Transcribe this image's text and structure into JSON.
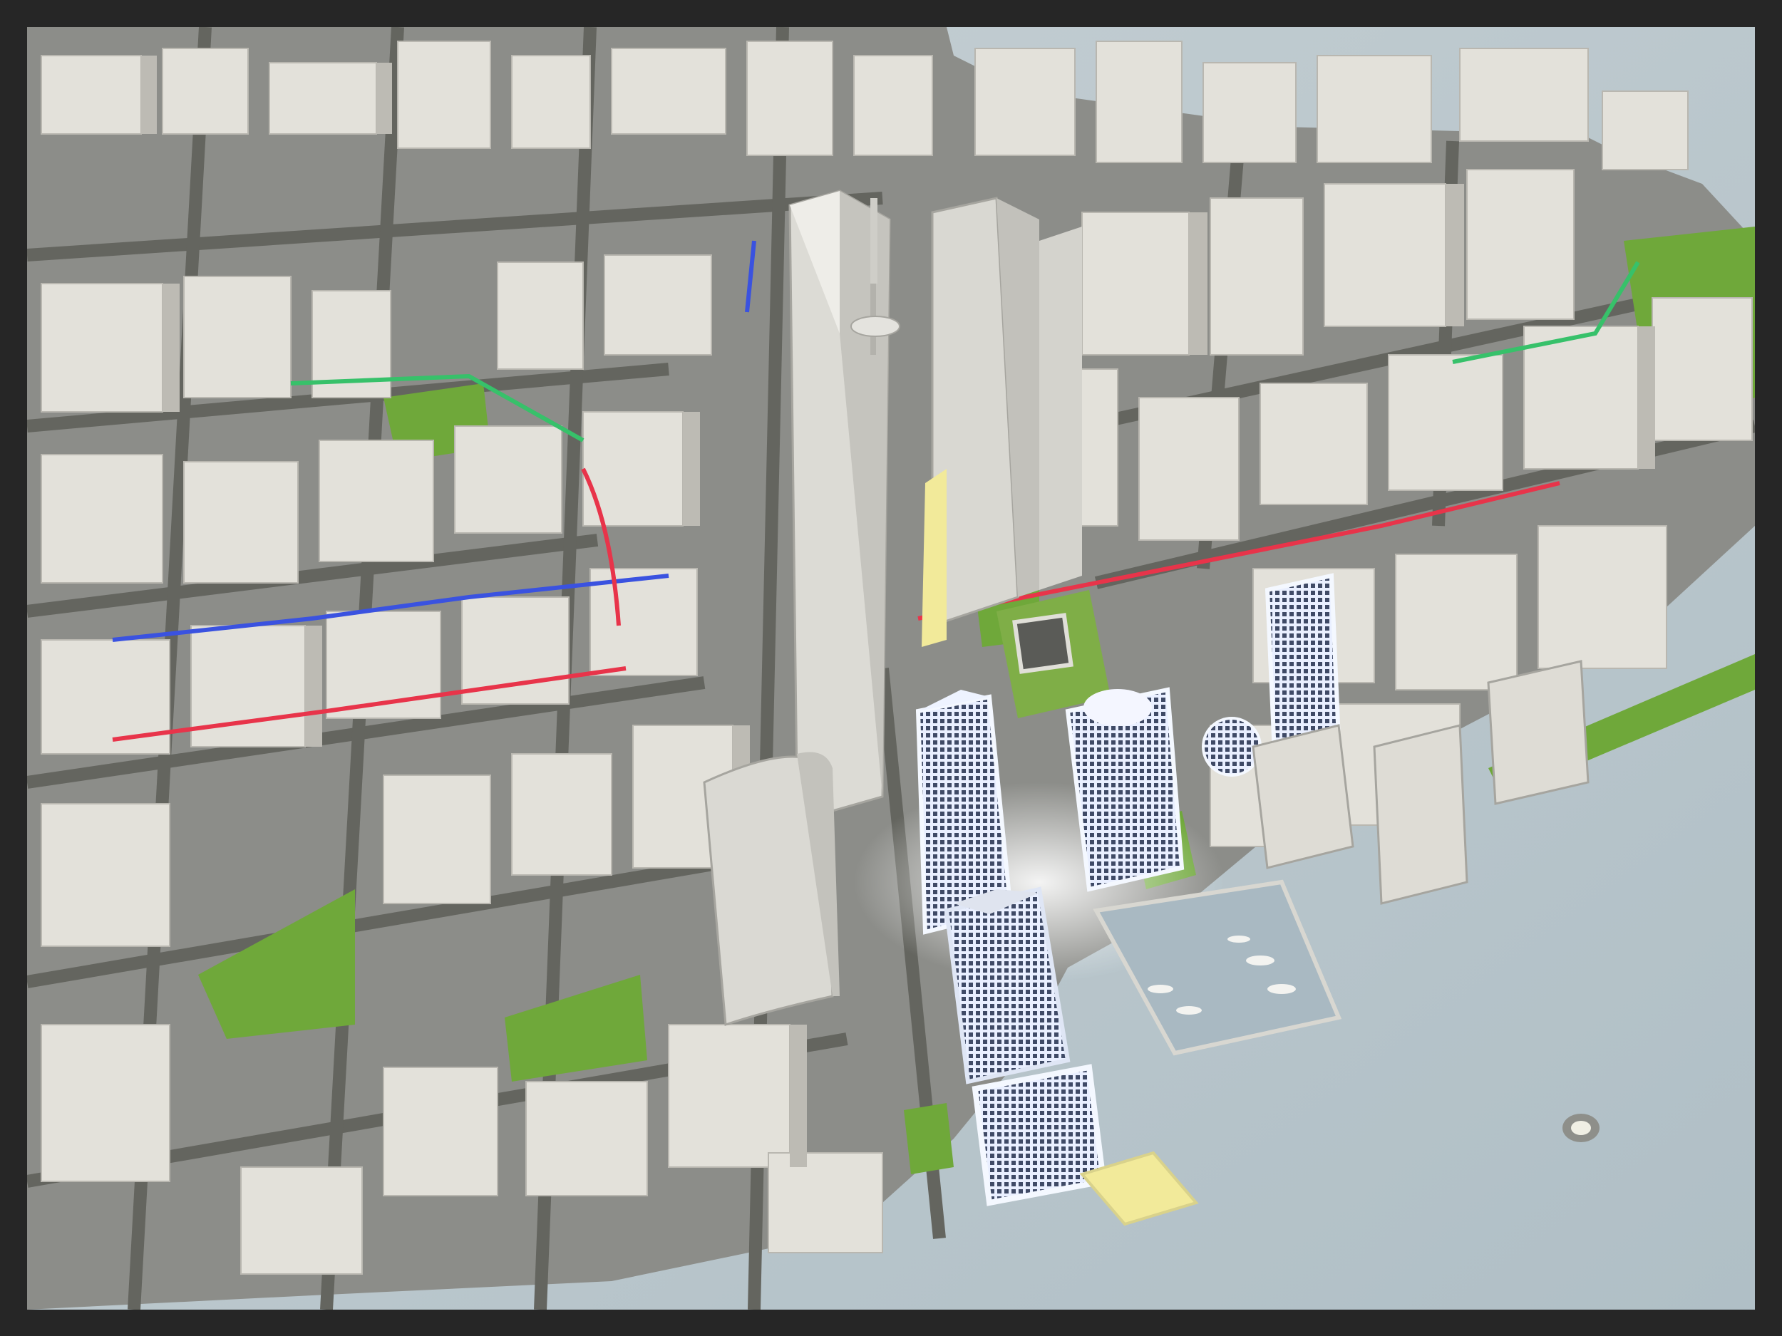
{
  "image": {
    "kind": "photograph",
    "subject": "architectural-model",
    "colors": {
      "frame": "#262626",
      "model_white": "#e8e6e0",
      "street": "#6f706d",
      "park_green": "#6fa83a",
      "water_plate": "#b8c6cd",
      "lit_blue": "#dfeaff",
      "lit_yellow": "#f2ea9a",
      "transit_red": "#e8344a",
      "transit_blue": "#3a52e0",
      "transit_green": "#37c16a"
    }
  }
}
